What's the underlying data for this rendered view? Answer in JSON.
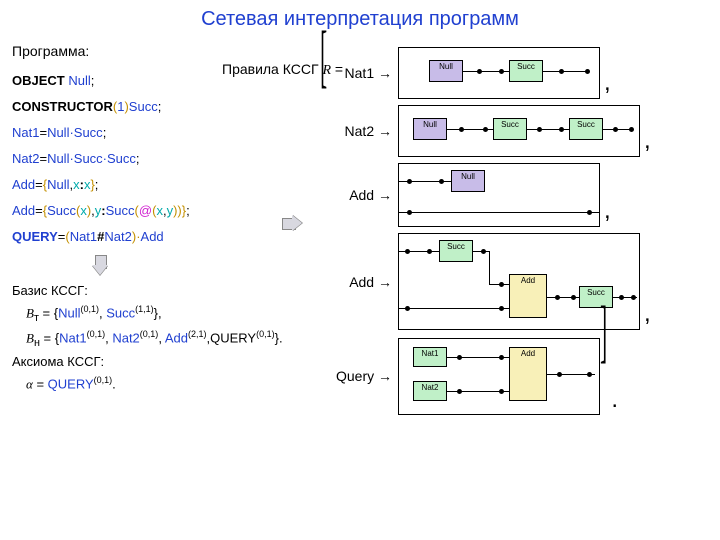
{
  "title": "Сетевая интерпретация программ",
  "left": {
    "program_label": "Программа:",
    "lines": {
      "l1_kw": "OBJECT",
      "l1_b": "Null",
      "l1_end": ";",
      "l2_kw": "CONSTRUCTOR",
      "l2_p1": "(",
      "l2_n": "1",
      "l2_p2": ")",
      "l2_b": "Succ",
      "l2_end": ";",
      "l3_a": "Nat1",
      "l3_mid": "=",
      "l3_b": "Null·Succ",
      "l3_end": ";",
      "l4_a": "Nat2",
      "l4_mid": "=",
      "l4_b": "Null·Succ·Succ",
      "l4_end": ";",
      "l5_a": "Add",
      "l5_mid": "=",
      "l5_b1": "{",
      "l5_c": "Null",
      "l5_d": ",",
      "l5_e": "x",
      "l5_f": ":",
      "l5_g": "x",
      "l5_b2": "}",
      "l5_end": ";",
      "l6_a": "Add",
      "l6_mid": "=",
      "l6_b1": "{",
      "l6_c": "Succ",
      "l6_p1": "(",
      "l6_d": "x",
      "l6_p2": ")",
      "l6_e": ",",
      "l6_f": "y",
      "l6_g": ":",
      "l6_h": "Succ",
      "l6_p3": "(",
      "l6_at": "@",
      "l6_p4": "(",
      "l6_i": "x",
      "l6_j": ",",
      "l6_k": "y",
      "l6_p5": ")",
      "l6_p6": ")",
      "l6_b2": "}",
      "l6_end": ";",
      "l7_kw": "QUERY",
      "l7_mid": "=",
      "l7_p1": "(",
      "l7_a": "Nat1",
      "l7_h": "#",
      "l7_b": "Nat2",
      "l7_p2": ")·",
      "l7_c": "Add"
    },
    "basis_label": "Базис КССГ:",
    "basis_bt": "B",
    "basis_bt_sub": "т",
    "basis_bt_eq": " = {",
    "basis_bt_1": "Null",
    "basis_bt_1s": "(0,1)",
    "basis_bt_c": ", ",
    "basis_bt_2": "Succ",
    "basis_bt_2s": "(1,1)",
    "basis_bt_end": "},",
    "basis_bn": "B",
    "basis_bn_sub": "н",
    "basis_bn_eq": " = {",
    "basis_bn_1": "Nat1",
    "basis_bn_1s": "(0,1)",
    "basis_bn_c1": ", ",
    "basis_bn_2": "Nat2",
    "basis_bn_2s": "(0,1)",
    "basis_bn_c2": ", ",
    "basis_bn_3": "Add",
    "basis_bn_3s": "(2,1)",
    "basis_bn_c3": ",",
    "basis_bn_4": "QUERY",
    "basis_bn_4s": "(0,1)",
    "basis_bn_end": "}.",
    "axiom_label": "Аксиома КССГ:",
    "axiom_a": "α",
    "axiom_eq": " = ",
    "axiom_q": "QUERY",
    "axiom_qs": "(0,1)",
    "axiom_end": "."
  },
  "right": {
    "rules_label": "Правила КССГ ",
    "rules_r": "R",
    "rules_eq": " =",
    "labels": {
      "nat1": "Nat1 →",
      "nat2": "Nat2 →",
      "add1": "Add →",
      "add2": "Add →",
      "query": "Query →"
    },
    "boxnames": {
      "null": "Null",
      "succ": "Succ",
      "add": "Add",
      "nat1": "Nat1",
      "nat2": "Nat2"
    }
  }
}
